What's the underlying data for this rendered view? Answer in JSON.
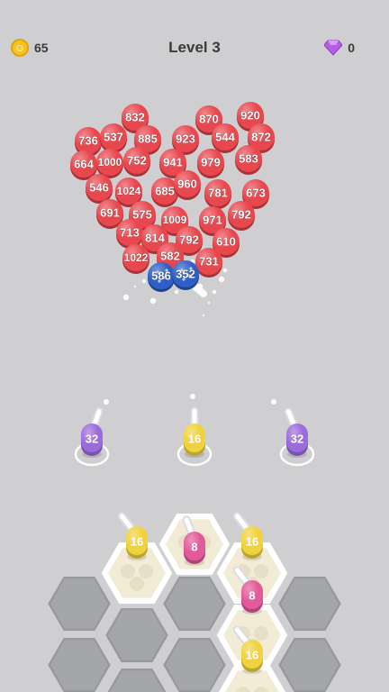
{
  "hud": {
    "coins": "65",
    "level": "Level 3",
    "gems": "0"
  },
  "colors": {
    "red": "#e8474e",
    "blue": "#2e5ec6",
    "purple": "#9b6bdc",
    "yellow": "#f0d23e",
    "pink": "#e25a9a",
    "hexEmpty": "#a4a6aa",
    "hexFilled": "#f2ecd6",
    "background": "#cfcfd1"
  },
  "targets": [
    {
      "v": "832",
      "c": "red"
    },
    {
      "v": "870",
      "c": "red"
    },
    {
      "v": "920",
      "c": "red"
    },
    {
      "v": "736",
      "c": "red"
    },
    {
      "v": "537",
      "c": "red"
    },
    {
      "v": "885",
      "c": "red"
    },
    {
      "v": "923",
      "c": "red"
    },
    {
      "v": "544",
      "c": "red"
    },
    {
      "v": "872",
      "c": "red"
    },
    {
      "v": "664",
      "c": "red"
    },
    {
      "v": "1000",
      "c": "red"
    },
    {
      "v": "752",
      "c": "red"
    },
    {
      "v": "941",
      "c": "red"
    },
    {
      "v": "979",
      "c": "red"
    },
    {
      "v": "583",
      "c": "red"
    },
    {
      "v": "546",
      "c": "red"
    },
    {
      "v": "1024",
      "c": "red"
    },
    {
      "v": "685",
      "c": "red"
    },
    {
      "v": "960",
      "c": "red"
    },
    {
      "v": "781",
      "c": "red"
    },
    {
      "v": "673",
      "c": "red"
    },
    {
      "v": "691",
      "c": "red"
    },
    {
      "v": "575",
      "c": "red"
    },
    {
      "v": "1009",
      "c": "red"
    },
    {
      "v": "971",
      "c": "red"
    },
    {
      "v": "792",
      "c": "red"
    },
    {
      "v": "713",
      "c": "red"
    },
    {
      "v": "814",
      "c": "red"
    },
    {
      "v": "792",
      "c": "red"
    },
    {
      "v": "610",
      "c": "red"
    },
    {
      "v": "582",
      "c": "red"
    },
    {
      "v": "1022",
      "c": "red"
    },
    {
      "v": "731",
      "c": "red"
    },
    {
      "v": "586",
      "c": "blue"
    },
    {
      "v": "352",
      "c": "blue"
    }
  ],
  "cannons": [
    {
      "v": "32",
      "c": "purple"
    },
    {
      "v": "16",
      "c": "yellow"
    },
    {
      "v": "32",
      "c": "purple"
    }
  ],
  "board": [
    {
      "v": "16",
      "c": "yellow"
    },
    {
      "v": "8",
      "c": "pink"
    },
    {
      "v": "16",
      "c": "yellow"
    },
    {
      "v": "8",
      "c": "pink"
    },
    {
      "v": "16",
      "c": "yellow"
    }
  ]
}
